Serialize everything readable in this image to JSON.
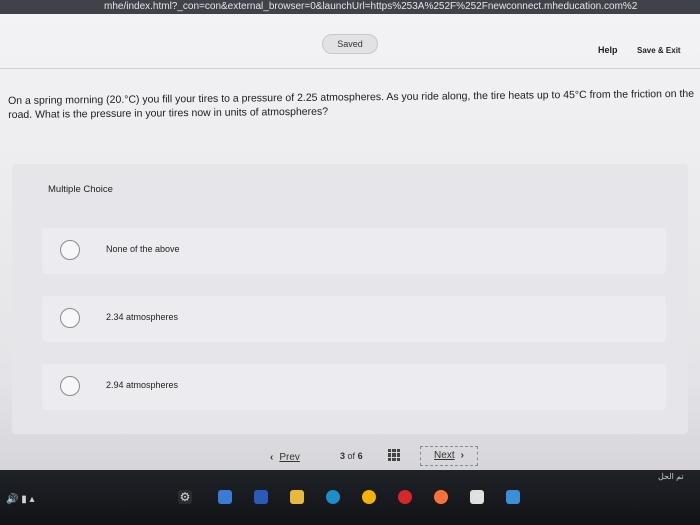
{
  "browser": {
    "url": "mhe/index.html?_con=con&external_browser=0&launchUrl=https%253A%252F%252Fnewconnect.mheducation.com%2"
  },
  "header": {
    "saved_label": "Saved",
    "help_label": "Help",
    "save_exit_label": "Save & Exit"
  },
  "question": {
    "text": "On a spring morning (20.°C) you fill your tires to a pressure of 2.25 atmospheres. As you ride along, the tire heats up to 45°C from the friction on the road. What is the pressure in your tires now in units of atmospheres?"
  },
  "answer": {
    "type_label": "Multiple Choice",
    "options": [
      {
        "label": "None of the above"
      },
      {
        "label": "2.34 atmospheres"
      },
      {
        "label": "2.94 atmospheres"
      }
    ]
  },
  "navigation": {
    "prev_label": "Prev",
    "page_current": "3",
    "page_of": "of",
    "page_total": "6",
    "next_label": "Next"
  },
  "taskbar": {
    "corner_text": "تم الحل"
  }
}
